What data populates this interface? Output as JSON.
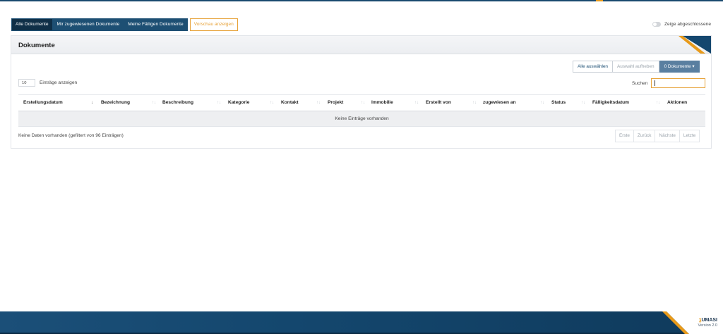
{
  "tabs": [
    {
      "label": "Alle Dokumente"
    },
    {
      "label": "Mir zugewiesenen Dokumente"
    },
    {
      "label": "Meine Fälligen Dokumente"
    },
    {
      "label": "Vorschau anzeigen"
    }
  ],
  "toggle": {
    "label": "Zeige abgeschlossene",
    "state": "off"
  },
  "panel": {
    "title": "Dokumente"
  },
  "toolbar": {
    "select_all": "Alle auswählen",
    "deselect": "Auswahl aufheben",
    "documents_button": "0 Dokumente"
  },
  "table_controls": {
    "length_value": "10",
    "length_label": "Einträge anzeigen",
    "search_label": "Suchen",
    "search_value": ""
  },
  "table": {
    "columns": [
      "Erstellungsdatum",
      "Bezeichnung",
      "Beschreibung",
      "Kategorie",
      "Kontakt",
      "Projekt",
      "Immobilie",
      "Erstellt von",
      "zugewiesen an",
      "Status",
      "Fälligkeitsdatum",
      "Aktionen"
    ],
    "empty_text": "Keine Einträge vorhanden"
  },
  "info": {
    "text": "Keine Daten vorhanden (gefiltert von 96 Einträgen)"
  },
  "pagination": [
    "Erste",
    "Zurück",
    "Nächste",
    "Letzte"
  ],
  "footer": {
    "brand": "UMASI",
    "version": "Version 2.0"
  },
  "colors": {
    "primary": "#1d4f73",
    "accent": "#e7a33a",
    "footer": "#14476e"
  }
}
